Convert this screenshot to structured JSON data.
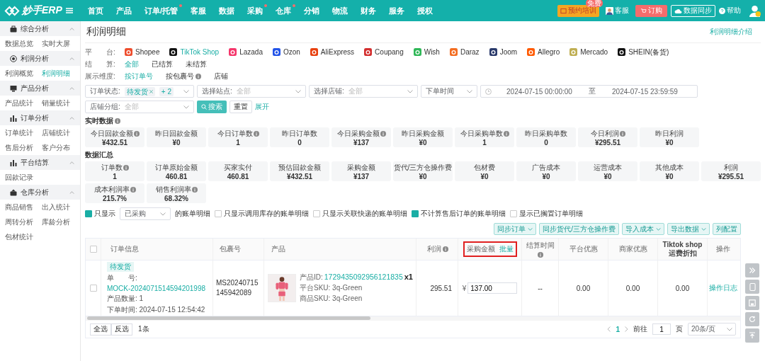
{
  "brand": "妙手ERP",
  "nav": [
    {
      "label": "首页",
      "dot": false
    },
    {
      "label": "产品",
      "dot": false
    },
    {
      "label": "订单/托管",
      "dot": true
    },
    {
      "label": "客服",
      "dot": false
    },
    {
      "label": "数据",
      "dot": false
    },
    {
      "label": "采购",
      "dot": true
    },
    {
      "label": "仓库",
      "dot": true
    },
    {
      "label": "分销",
      "dot": false
    },
    {
      "label": "物流",
      "dot": false
    },
    {
      "label": "财务",
      "dot": false
    },
    {
      "label": "服务",
      "dot": false
    },
    {
      "label": "授权",
      "dot": false
    }
  ],
  "top_actions": {
    "training": "预约培训",
    "training_badge": "免费",
    "service": "客服",
    "order": "订购",
    "sync": "数据同步",
    "help": "帮助"
  },
  "sidebar": [
    {
      "title": "综合分析",
      "expanded": true,
      "items": [
        {
          "label": "数据总览",
          "selected": false
        },
        {
          "label": "实时大屏",
          "selected": false
        }
      ]
    },
    {
      "title": "利润分析",
      "expanded": true,
      "items": [
        {
          "label": "利润概览",
          "selected": false
        },
        {
          "label": "利润明细",
          "selected": true
        }
      ]
    },
    {
      "title": "产品分析",
      "expanded": true,
      "items": [
        {
          "label": "产品统计",
          "selected": false
        },
        {
          "label": "销量统计",
          "selected": false
        }
      ]
    },
    {
      "title": "订单分析",
      "expanded": true,
      "items": [
        {
          "label": "订单统计",
          "selected": false
        },
        {
          "label": "店铺统计",
          "selected": false
        },
        {
          "label": "售后分析",
          "selected": false
        },
        {
          "label": "客户分布",
          "selected": false
        }
      ]
    },
    {
      "title": "平台结算",
      "expanded": true,
      "items": [
        {
          "label": "回款记录",
          "selected": false
        }
      ]
    },
    {
      "title": "仓库分析",
      "expanded": true,
      "items": [
        {
          "label": "商品销售",
          "selected": false
        },
        {
          "label": "出入统计",
          "selected": false
        },
        {
          "label": "周转分析",
          "selected": false
        },
        {
          "label": "库龄分析",
          "selected": false
        },
        {
          "label": "包材统计",
          "selected": false
        }
      ]
    }
  ],
  "page": {
    "title": "利润明细",
    "help_link": "利润明细介绍"
  },
  "platforms": {
    "label": "平　　台:",
    "options": [
      {
        "label": "Shopee",
        "selected": false,
        "color": "#ee4d2d"
      },
      {
        "label": "TikTok Shop",
        "selected": true,
        "color": "#111111"
      },
      {
        "label": "Lazada",
        "selected": false,
        "color": "#f5366b"
      },
      {
        "label": "Ozon",
        "selected": false,
        "color": "#2354e8"
      },
      {
        "label": "AliExpress",
        "selected": false,
        "color": "#e8410f"
      },
      {
        "label": "Coupang",
        "selected": false,
        "color": "#d32f2f"
      },
      {
        "label": "Wish",
        "selected": false,
        "color": "#2fb757"
      },
      {
        "label": "Daraz",
        "selected": false,
        "color": "#f36d21"
      },
      {
        "label": "Joom",
        "selected": false,
        "color": "#2a3a6b"
      },
      {
        "label": "Allegro",
        "selected": false,
        "color": "#ff5a00"
      },
      {
        "label": "Mercado",
        "selected": false,
        "color": "#bfae52"
      },
      {
        "label": "SHEIN(备货)",
        "selected": false,
        "color": "#111111"
      }
    ]
  },
  "settlement": {
    "label": "结　　算:",
    "options": [
      {
        "label": "全部",
        "selected": true
      },
      {
        "label": "已结算",
        "selected": false
      },
      {
        "label": "未结算",
        "selected": false
      }
    ]
  },
  "dimension": {
    "label": "展示维度:",
    "options": [
      {
        "label": "按订单号",
        "selected": true,
        "info": false
      },
      {
        "label": "按包裹号",
        "selected": false,
        "info": true
      },
      {
        "label": "店铺",
        "selected": false,
        "info": false
      }
    ]
  },
  "filters": {
    "order_status": {
      "label": "订单状态:",
      "tags": [
        "待发货"
      ],
      "more": "+ 2"
    },
    "site": {
      "label": "选择站点:",
      "placeholder": "全部"
    },
    "store": {
      "label": "选择店铺:",
      "placeholder": "全部"
    },
    "time_type": "下单时间",
    "date_start": "2024-07-15 00:00:00",
    "date_sep": "至",
    "date_end": "2024-07-15 23:59:59",
    "store_group": {
      "label": "店铺分组:",
      "placeholder": "全部"
    },
    "search": "搜索",
    "reset": "重置",
    "expand": "展开"
  },
  "realtime": {
    "title": "实时数据",
    "cards": [
      {
        "label": "今日回款金额",
        "info": true,
        "value": "¥432.51"
      },
      {
        "label": "昨日回款金额",
        "info": false,
        "value": "¥0"
      },
      {
        "label": "今日订单数",
        "info": true,
        "value": "1"
      },
      {
        "label": "昨日订单数",
        "info": false,
        "value": "0"
      },
      {
        "label": "今日采购金额",
        "info": true,
        "value": "¥137"
      },
      {
        "label": "昨日采购金额",
        "info": false,
        "value": "¥0"
      },
      {
        "label": "今日采购单数",
        "info": true,
        "value": "1"
      },
      {
        "label": "昨日采购单数",
        "info": false,
        "value": "0"
      },
      {
        "label": "今日利润",
        "info": true,
        "value": "¥295.51"
      },
      {
        "label": "昨日利润",
        "info": false,
        "value": "¥0"
      }
    ]
  },
  "summary": {
    "title": "数据汇总",
    "cards": [
      {
        "label": "订单数",
        "info": true,
        "value": "1"
      },
      {
        "label": "订单原始金额",
        "info": false,
        "value": "460.81"
      },
      {
        "label": "买家实付",
        "info": false,
        "value": "460.81"
      },
      {
        "label": "预估回款金额",
        "info": false,
        "value": "¥432.51"
      },
      {
        "label": "采购金额",
        "info": false,
        "value": "¥137"
      },
      {
        "label": "货代/三方仓操作费",
        "info": false,
        "value": "¥0"
      },
      {
        "label": "包材费",
        "info": false,
        "value": "¥0"
      },
      {
        "label": "广告成本",
        "info": false,
        "value": "¥0"
      },
      {
        "label": "运营成本",
        "info": false,
        "value": "¥0"
      },
      {
        "label": "其他成本",
        "info": false,
        "value": "¥0"
      },
      {
        "label": "利润",
        "info": false,
        "value": "¥295.51"
      },
      {
        "label": "成本利润率",
        "info": true,
        "value": "215.7%"
      },
      {
        "label": "销售利润率",
        "info": true,
        "value": "68.32%"
      }
    ]
  },
  "options_bar": {
    "only_show": {
      "label": "只显示",
      "checked": true
    },
    "only_show_select": "已采购",
    "only_show_suffix": "的账单明细",
    "checks": [
      {
        "label": "只显示调用库存的账单明细",
        "checked": false
      },
      {
        "label": "只显示关联快递的账单明细",
        "checked": false
      },
      {
        "label": "不计算售后订单的账单明细",
        "checked": true
      },
      {
        "label": "显示已搁置订单明细",
        "checked": false
      }
    ],
    "buttons": [
      {
        "label": "同步订单",
        "caret": true
      },
      {
        "label": "同步货代/三方仓操作费",
        "caret": false
      },
      {
        "label": "导入成本",
        "caret": true
      },
      {
        "label": "导出数据",
        "caret": true
      },
      {
        "label": "列配置",
        "caret": false
      }
    ]
  },
  "table": {
    "header_checked": false,
    "columns": [
      {
        "label": "订单信息",
        "info": false,
        "highlighted": false
      },
      {
        "label": "包裹号",
        "info": false,
        "highlighted": false
      },
      {
        "label": "产品",
        "info": false,
        "highlighted": false
      },
      {
        "label": "利润",
        "info": true,
        "highlighted": false
      },
      {
        "label": "采购金额",
        "info": false,
        "highlighted": true,
        "link": "批量"
      },
      {
        "label": "结算时间",
        "info": true,
        "highlighted": false
      },
      {
        "label": "平台优惠",
        "info": false,
        "highlighted": false
      },
      {
        "label": "商家优惠",
        "info": false,
        "highlighted": false
      },
      {
        "label": "Tiktok shop 运费折扣",
        "info": false,
        "highlighted": false
      },
      {
        "label": "操作",
        "info": false,
        "highlighted": false
      }
    ],
    "rows": [
      {
        "checked": false,
        "status": "待发货",
        "order_no_label": "单　　号:",
        "order_no": "MOCK-2024071514594201998",
        "qty": "产品数量: 1",
        "time": "下单时间: 2024-07-15 12:54:42",
        "package": "MS20240715145942089",
        "product_id_label": "产品ID:",
        "product_id": "1729435092956121835",
        "product_qty": "x1",
        "platform_sku": "平台SKU:  3q-Green",
        "goods_sku": "商品SKU:  3q-Green",
        "profit": "295.51",
        "purchase_currency": "¥",
        "purchase": "137.00",
        "settle_time": "--",
        "platform_discount": "0.00",
        "seller_discount": "0.00",
        "shipping_discount": "0.00",
        "action": "操作日志"
      }
    ]
  },
  "footer": {
    "select_all": "全选",
    "invert": "反选",
    "count": "1条",
    "pages": [
      {
        "label": "1",
        "selected": true
      }
    ],
    "goto": "前往",
    "page_input": "1",
    "page_unit": "页",
    "page_size": "20条/页"
  }
}
